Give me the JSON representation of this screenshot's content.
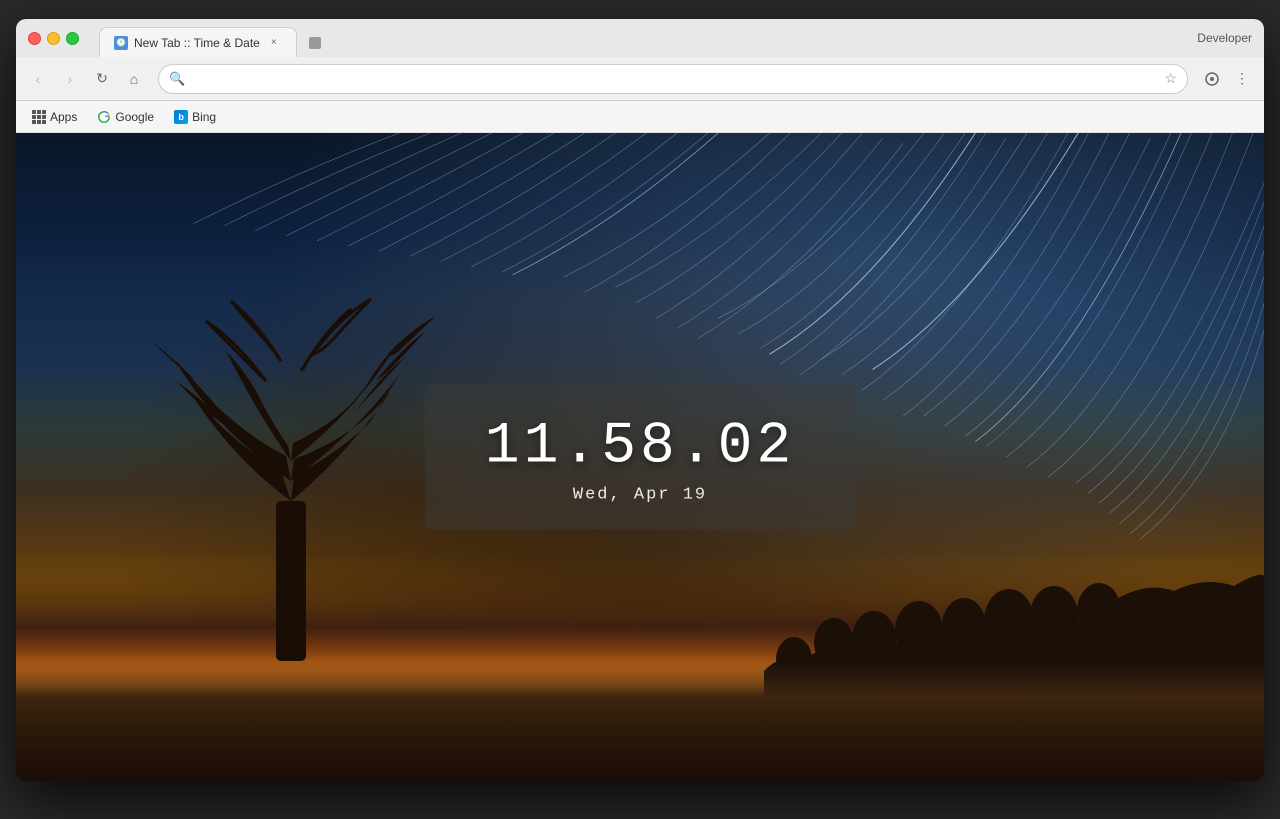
{
  "browser": {
    "title": "New Tab :: Time & Date",
    "developer_label": "Developer",
    "tab": {
      "title": "New Tab :: Time & Date",
      "close_label": "×"
    }
  },
  "toolbar": {
    "back_label": "‹",
    "forward_label": "›",
    "reload_label": "↻",
    "home_label": "⌂",
    "address_value": "",
    "address_placeholder": "",
    "bookmark_icon": "☆",
    "menu_icon": "⋮",
    "extensions_icon": "⚙"
  },
  "bookmarks": {
    "apps_label": "Apps",
    "google_label": "Google",
    "bing_label": "Bing"
  },
  "clock": {
    "time": "11.58.02",
    "date": "Wed, Apr 19"
  }
}
